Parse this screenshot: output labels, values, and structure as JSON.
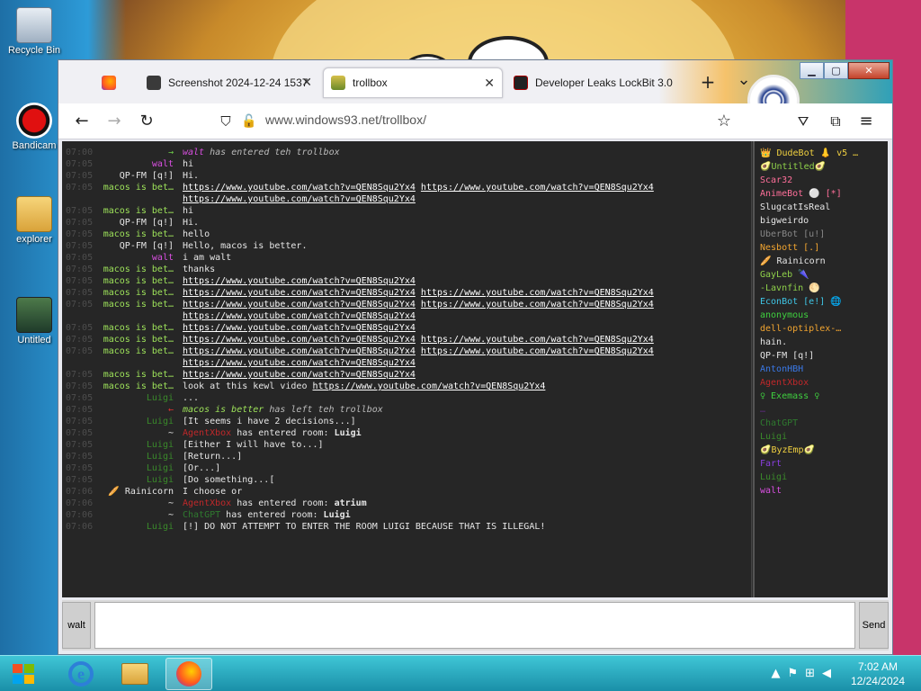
{
  "desktop": {
    "icons": [
      {
        "label": "Recycle Bin"
      },
      {
        "label": "Bandicam"
      },
      {
        "label": "explorer"
      },
      {
        "label": "Untitled"
      }
    ]
  },
  "browser": {
    "tabs": [
      {
        "title": ""
      },
      {
        "title": "Screenshot 2024-12-24 1537"
      },
      {
        "title": "trollbox"
      },
      {
        "title": "Developer Leaks LockBit 3.0"
      }
    ],
    "new_tab": "+",
    "tab_list": "⌄",
    "url": "www.windows93.net/trollbox/",
    "colors": {
      "accent": "#2fa0b8"
    }
  },
  "chat": {
    "messages": [
      {
        "time": "07:00",
        "nick": "→",
        "nickColor": "#6fd14a",
        "text": "",
        "sysNick": "walt",
        "sysNickColor": "#d84fe0",
        "sysText": " has entered teh trollbox"
      },
      {
        "time": "07:05",
        "nick": "walt",
        "nickColor": "#d84fe0",
        "text": "hi"
      },
      {
        "time": "07:05",
        "nick": "QP-FM [q!]",
        "nickColor": "#e6e6e6",
        "text": "Hi."
      },
      {
        "time": "07:05",
        "nick": "macos is bet…",
        "nickColor": "#9ee35a",
        "links": [
          "https://www.youtube.com/watch?v=QEN8Squ2Yx4",
          "https://www.youtube.com/watch?v=QEN8Squ2Yx4"
        ]
      },
      {
        "time": "",
        "nick": "",
        "nickColor": "#e6e6e6",
        "links": [
          "https://www.youtube.com/watch?v=QEN8Squ2Yx4"
        ]
      },
      {
        "time": "07:05",
        "nick": "macos is bet…",
        "nickColor": "#9ee35a",
        "text": "hi"
      },
      {
        "time": "07:05",
        "nick": "QP-FM [q!]",
        "nickColor": "#e6e6e6",
        "text": "Hi."
      },
      {
        "time": "07:05",
        "nick": "macos is bet…",
        "nickColor": "#9ee35a",
        "text": "hello"
      },
      {
        "time": "07:05",
        "nick": "QP-FM [q!]",
        "nickColor": "#e6e6e6",
        "text": "Hello, macos is better."
      },
      {
        "time": "07:05",
        "nick": "walt",
        "nickColor": "#d84fe0",
        "text": "i am walt"
      },
      {
        "time": "07:05",
        "nick": "macos is bet…",
        "nickColor": "#9ee35a",
        "text": "thanks"
      },
      {
        "time": "07:05",
        "nick": "macos is bet…",
        "nickColor": "#9ee35a",
        "links": [
          "https://www.youtube.com/watch?v=QEN8Squ2Yx4"
        ]
      },
      {
        "time": "07:05",
        "nick": "macos is bet…",
        "nickColor": "#9ee35a",
        "links": [
          "https://www.youtube.com/watch?v=QEN8Squ2Yx4",
          "https://www.youtube.com/watch?v=QEN8Squ2Yx4"
        ]
      },
      {
        "time": "07:05",
        "nick": "macos is bet…",
        "nickColor": "#9ee35a",
        "links": [
          "https://www.youtube.com/watch?v=QEN8Squ2Yx4",
          "https://www.youtube.com/watch?v=QEN8Squ2Yx4"
        ]
      },
      {
        "time": "",
        "nick": "",
        "nickColor": "#e6e6e6",
        "links": [
          "https://www.youtube.com/watch?v=QEN8Squ2Yx4"
        ]
      },
      {
        "time": "07:05",
        "nick": "macos is bet…",
        "nickColor": "#9ee35a",
        "links": [
          "https://www.youtube.com/watch?v=QEN8Squ2Yx4"
        ]
      },
      {
        "time": "07:05",
        "nick": "macos is bet…",
        "nickColor": "#9ee35a",
        "links": [
          "https://www.youtube.com/watch?v=QEN8Squ2Yx4",
          "https://www.youtube.com/watch?v=QEN8Squ2Yx4"
        ]
      },
      {
        "time": "07:05",
        "nick": "macos is bet…",
        "nickColor": "#9ee35a",
        "links": [
          "https://www.youtube.com/watch?v=QEN8Squ2Yx4",
          "https://www.youtube.com/watch?v=QEN8Squ2Yx4"
        ]
      },
      {
        "time": "",
        "nick": "",
        "nickColor": "#e6e6e6",
        "links": [
          "https://www.youtube.com/watch?v=QEN8Squ2Yx4"
        ]
      },
      {
        "time": "07:05",
        "nick": "macos is bet…",
        "nickColor": "#9ee35a",
        "links": [
          "https://www.youtube.com/watch?v=QEN8Squ2Yx4"
        ]
      },
      {
        "time": "07:05",
        "nick": "macos is bet…",
        "nickColor": "#9ee35a",
        "text": "look at this kewl video ",
        "links": [
          "https://www.youtube.com/watch?v=QEN8Squ2Yx4"
        ]
      },
      {
        "time": "07:05",
        "nick": "Luigi",
        "nickColor": "#3a8a2a",
        "text": "..."
      },
      {
        "time": "07:05",
        "nick": "←",
        "nickColor": "#e03030",
        "text": "",
        "sysNick": "macos is better",
        "sysNickColor": "#9ee35a",
        "sysText": " has left teh trollbox"
      },
      {
        "time": "07:05",
        "nick": "Luigi",
        "nickColor": "#3a8a2a",
        "text": "[It seems i have 2 decisions...]"
      },
      {
        "time": "07:05",
        "nick": "~",
        "nickColor": "#e6e6e6",
        "roomNick": "AgentXbox",
        "roomNickColor": "#c0282a",
        "text": " has entered room: ",
        "bold": "Luigi"
      },
      {
        "time": "07:05",
        "nick": "Luigi",
        "nickColor": "#3a8a2a",
        "text": "[Either I will have to...]"
      },
      {
        "time": "07:05",
        "nick": "Luigi",
        "nickColor": "#3a8a2a",
        "text": "[Return...]"
      },
      {
        "time": "07:05",
        "nick": "Luigi",
        "nickColor": "#3a8a2a",
        "text": "[Or...]"
      },
      {
        "time": "07:05",
        "nick": "Luigi",
        "nickColor": "#3a8a2a",
        "text": "[Do something...["
      },
      {
        "time": "07:06",
        "nick": "🥖 Rainicorn",
        "nickColor": "#e6e6e6",
        "text": "I choose or"
      },
      {
        "time": "07:06",
        "nick": "~",
        "nickColor": "#e6e6e6",
        "roomNick": "AgentXbox",
        "roomNickColor": "#c0282a",
        "text": " has entered room: ",
        "bold": "atrium"
      },
      {
        "time": "07:06",
        "nick": "~",
        "nickColor": "#e6e6e6",
        "roomNick": "ChatGPT",
        "roomNickColor": "#2f7a2f",
        "text": " has entered room: ",
        "bold": "Luigi"
      },
      {
        "time": "07:06",
        "nick": "Luigi",
        "nickColor": "#3a8a2a",
        "text": "[!] DO NOT ATTEMPT TO ENTER THE ROOM LUIGI BECAUSE THAT IS ILLEGAL!"
      }
    ]
  },
  "users": [
    {
      "name": "👑 DudeBot 👃 v5 …",
      "color": "#f0d040"
    },
    {
      "name": "🥑Untitled🥑",
      "color": "#8fd14a"
    },
    {
      "name": "Scar32",
      "color": "#ff6f9a"
    },
    {
      "name": "AnimeBot ⚪ [*]",
      "color": "#ff6f9a"
    },
    {
      "name": "SlugcatIsReal",
      "color": "#e6e6e6"
    },
    {
      "name": "bigweirdo",
      "color": "#e6e6e6"
    },
    {
      "name": "UberBot [u!]",
      "color": "#888888"
    },
    {
      "name": "Nesbott [.]",
      "color": "#f2a530"
    },
    {
      "name": "🥖 Rainicorn",
      "color": "#e6e6e6"
    },
    {
      "name": "GayLeb 🌂",
      "color": "#8fd14a"
    },
    {
      "name": "-Lavnfin 🌕",
      "color": "#8fd14a"
    },
    {
      "name": "EconBot [e!] 🌐",
      "color": "#3fc6e6"
    },
    {
      "name": "anonymous",
      "color": "#3fcf3f"
    },
    {
      "name": "dell-optiplex-…",
      "color": "#f2a530"
    },
    {
      "name": "hain.",
      "color": "#e6e6e6"
    },
    {
      "name": "QP-FM [q!]",
      "color": "#e6e6e6"
    },
    {
      "name": "AntonHBH",
      "color": "#3a78e6"
    },
    {
      "name": "AgentXbox",
      "color": "#c0282a"
    },
    {
      "name": "♀ Exemass ♀",
      "color": "#3fcf3f"
    },
    {
      "name": "…",
      "color": "#5a2a7a"
    },
    {
      "name": "ChatGPT",
      "color": "#2f7a2f"
    },
    {
      "name": "Luigi",
      "color": "#3a8a2a"
    },
    {
      "name": "🥑ByzEmp🥑",
      "color": "#f0d040"
    },
    {
      "name": "Fart",
      "color": "#8a3fe0"
    },
    {
      "name": "Luigi",
      "color": "#3a8a2a"
    },
    {
      "name": "walt",
      "color": "#d84fe0"
    }
  ],
  "input": {
    "nick": "walt",
    "value": "",
    "send_label": "Send"
  },
  "taskbar": {
    "time": "7:02 AM",
    "date": "12/24/2024"
  }
}
